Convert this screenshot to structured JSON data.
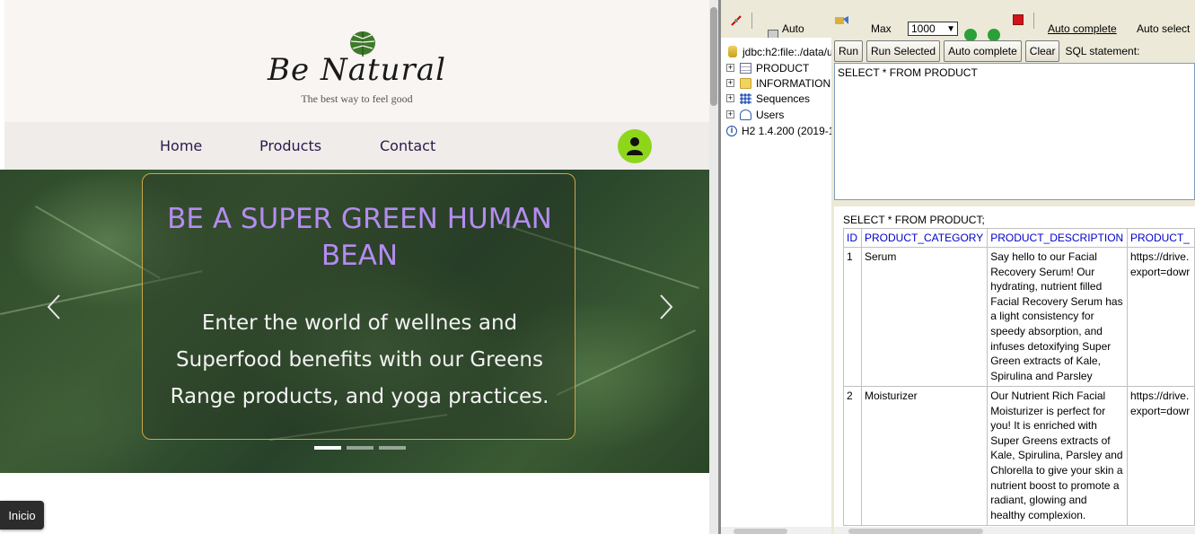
{
  "site": {
    "brand": "Be Natural",
    "tagline": "The best way to feel good",
    "nav": [
      "Home",
      "Products",
      "Contact"
    ],
    "hero": {
      "title": "BE A SUPER GREEN HUMAN BEAN",
      "body": "Enter the world of wellnes and Superfood benefits with our Greens Range products, and yoga practices."
    },
    "carousel_active_slide": 1,
    "carousel_slide_count": 3,
    "start_button": "Inicio"
  },
  "console": {
    "toolbar": {
      "auto_commit": "Auto",
      "max_label": "Max",
      "max_value": "1000",
      "auto_complete": "Auto complete",
      "auto_select": "Auto select"
    },
    "tree": {
      "connection": "jdbc:h2:file:./data/u",
      "items": [
        "PRODUCT",
        "INFORMATION",
        "Sequences",
        "Users"
      ],
      "version": "H2 1.4.200 (2019-1"
    },
    "buttons": {
      "run": "Run",
      "run_selected": "Run Selected",
      "auto_complete": "Auto complete",
      "clear": "Clear",
      "sql_statement": "SQL statement:"
    },
    "sql": "SELECT * FROM PRODUCT",
    "result_echo": "SELECT * FROM PRODUCT;",
    "columns": [
      "ID",
      "PRODUCT_CATEGORY",
      "PRODUCT_DESCRIPTION",
      "PRODUCT_"
    ],
    "rows": [
      {
        "id": "1",
        "category": "Serum",
        "description": "Say hello to our Facial Recovery Serum! Our hydrating, nutrient filled Facial Recovery Serum has a light consistency for speedy absorption, and infuses detoxifying Super Green extracts of Kale, Spirulina and Parsley",
        "image": "https://drive. export=dowr"
      },
      {
        "id": "2",
        "category": "Moisturizer",
        "description": "Our Nutrient Rich Facial Moisturizer is perfect for you! It is enriched with Super Greens extracts of Kale, Spirulina, Parsley and Chlorella to give your skin a nutrient boost to promote a radiant, glowing and healthy complexion.",
        "image": "https://drive. export=dowr"
      }
    ]
  }
}
